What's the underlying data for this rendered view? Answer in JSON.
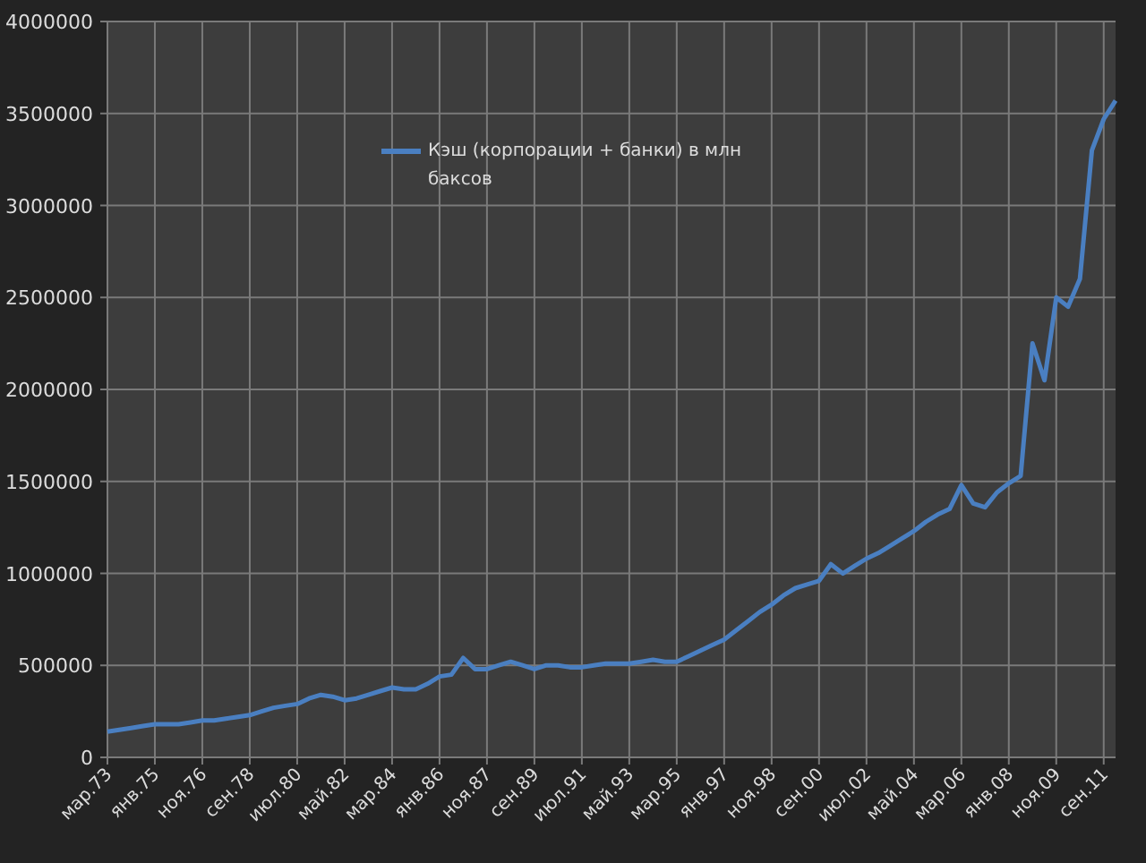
{
  "chart": {
    "chart_data": {
      "type": "line",
      "categories": [
        "мар.73",
        null,
        null,
        null,
        "янв.75",
        null,
        null,
        null,
        "ноя.76",
        null,
        null,
        null,
        "сен.78",
        null,
        null,
        null,
        "июл.80",
        null,
        null,
        null,
        "май.82",
        null,
        null,
        null,
        "мар.84",
        null,
        null,
        null,
        "янв.86",
        null,
        null,
        null,
        "ноя.87",
        null,
        null,
        null,
        "сен.89",
        null,
        null,
        null,
        "июл.91",
        null,
        null,
        null,
        "май.93",
        null,
        null,
        null,
        "мар.95",
        null,
        null,
        null,
        "янв.97",
        null,
        null,
        null,
        "ноя.98",
        null,
        null,
        null,
        "сен.00",
        null,
        null,
        null,
        "июл.02",
        null,
        null,
        null,
        "май.04",
        null,
        null,
        null,
        "мар.06",
        null,
        null,
        null,
        "янв.08",
        null,
        null,
        null,
        "ноя.09",
        null,
        null,
        null,
        "сен.11",
        null
      ],
      "series": [
        {
          "name": "Кэш (корпорации + банки) в млн баксов",
          "color": "#4a7fc1",
          "values": [
            140000,
            150000,
            160000,
            170000,
            180000,
            180000,
            180000,
            190000,
            200000,
            200000,
            210000,
            220000,
            230000,
            250000,
            270000,
            280000,
            290000,
            320000,
            340000,
            330000,
            310000,
            320000,
            340000,
            360000,
            380000,
            370000,
            370000,
            400000,
            440000,
            450000,
            540000,
            480000,
            480000,
            500000,
            520000,
            500000,
            480000,
            500000,
            500000,
            490000,
            490000,
            500000,
            510000,
            510000,
            510000,
            520000,
            530000,
            520000,
            520000,
            550000,
            580000,
            610000,
            640000,
            690000,
            740000,
            790000,
            830000,
            880000,
            920000,
            940000,
            960000,
            1050000,
            1000000,
            1040000,
            1080000,
            1110000,
            1150000,
            1190000,
            1230000,
            1280000,
            1320000,
            1350000,
            1480000,
            1380000,
            1360000,
            1440000,
            1490000,
            1530000,
            2250000,
            2050000,
            2500000,
            2450000,
            2600000,
            3300000,
            3470000,
            3570000
          ]
        }
      ],
      "ylim": [
        0,
        4000000
      ],
      "grid": true,
      "yticks": [
        0,
        500000,
        1000000,
        1500000,
        2000000,
        2500000,
        3000000,
        3500000,
        4000000
      ]
    }
  }
}
